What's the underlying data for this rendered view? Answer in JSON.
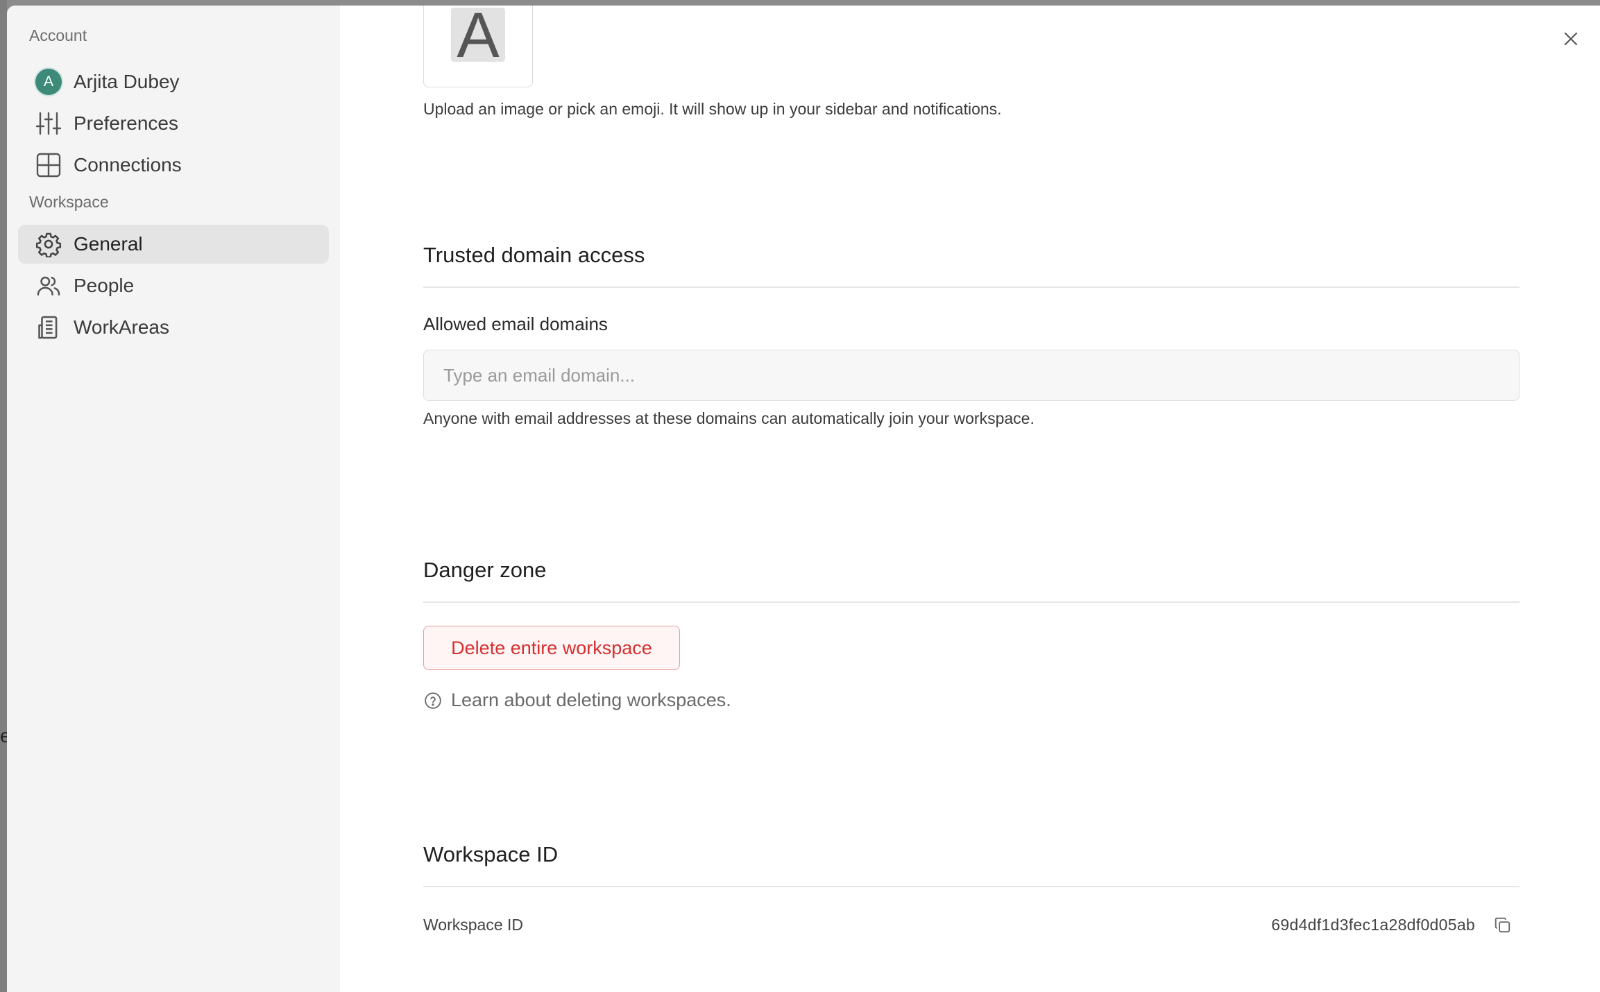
{
  "sidebar": {
    "account_label": "Account",
    "workspace_label": "Workspace",
    "account_items": [
      {
        "label": "Arjita Dubey",
        "icon": "avatar",
        "avatar_letter": "A"
      },
      {
        "label": "Preferences",
        "icon": "sliders-icon"
      },
      {
        "label": "Connections",
        "icon": "grid-icon"
      }
    ],
    "workspace_items": [
      {
        "label": "General",
        "icon": "gear-icon",
        "active": true
      },
      {
        "label": "People",
        "icon": "people-icon"
      },
      {
        "label": "WorkAreas",
        "icon": "building-icon"
      }
    ]
  },
  "main": {
    "workspace_icon_letter": "A",
    "icon_help": "Upload an image or pick an emoji. It will show up in your sidebar and notifications.",
    "trusted_domain": {
      "heading": "Trusted domain access",
      "field_label": "Allowed email domains",
      "placeholder": "Type an email domain...",
      "value": "",
      "help": "Anyone with email addresses at these domains can automatically join your workspace."
    },
    "danger_zone": {
      "heading": "Danger zone",
      "delete_button": "Delete entire workspace",
      "learn_link": "Learn about deleting workspaces."
    },
    "workspace_id": {
      "heading": "Workspace ID",
      "label": "Workspace ID",
      "value": "69d4df1d3fec1a28df0d05ab"
    }
  },
  "colors": {
    "danger": "#d62f2f",
    "avatar": "#3d8a78",
    "sidebar_bg": "#f4f4f4",
    "active_bg": "#e4e4e4"
  }
}
